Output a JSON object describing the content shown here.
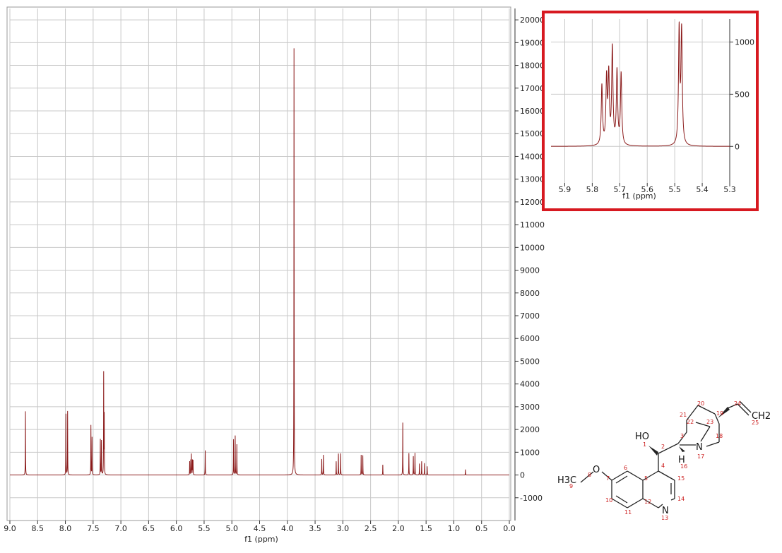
{
  "chart_data": [
    {
      "type": "line",
      "xlabel": "f1 (ppm)",
      "ylabel": "",
      "xlim": [
        9.0,
        0.0
      ],
      "ylim": [
        -2000,
        20500
      ],
      "x_ticks": [
        9.0,
        8.5,
        8.0,
        7.5,
        7.0,
        6.5,
        6.0,
        5.5,
        5.0,
        4.5,
        4.0,
        3.5,
        3.0,
        2.5,
        2.0,
        1.5,
        1.0,
        0.5,
        0.0
      ],
      "x_tick_labels": [
        "9.0",
        "8.5",
        "8.0",
        "7.5",
        "7.0",
        "6.5",
        "6.0",
        "5.5",
        "5.0",
        "4.5",
        "4.0",
        "3.5",
        "3.0",
        "2.5",
        "2.0",
        "1.5",
        "1.0",
        "0.5",
        "0.0"
      ],
      "y_ticks": [
        -1000,
        0,
        1000,
        2000,
        3000,
        4000,
        5000,
        6000,
        7000,
        8000,
        9000,
        10000,
        11000,
        12000,
        13000,
        14000,
        15000,
        16000,
        17000,
        18000,
        19000,
        20000
      ],
      "y_tick_labels": [
        "-1000",
        "0",
        "1000",
        "2000",
        "3000",
        "4000",
        "5000",
        "6000",
        "7000",
        "8000",
        "9000",
        "10000",
        "11000",
        "12000",
        "13000",
        "14000",
        "15000",
        "16000",
        "17000",
        "18000",
        "19000",
        "20000"
      ],
      "grid": true,
      "line_color": "#8b1a1a",
      "series": [
        {
          "peaks": [
            {
              "x": 8.72,
              "y": 2800
            },
            {
              "x": 7.99,
              "y": 2680
            },
            {
              "x": 7.96,
              "y": 2800
            },
            {
              "x": 7.54,
              "y": 2180
            },
            {
              "x": 7.52,
              "y": 1650
            },
            {
              "x": 7.37,
              "y": 1560
            },
            {
              "x": 7.35,
              "y": 1500
            },
            {
              "x": 7.31,
              "y": 4440
            },
            {
              "x": 7.3,
              "y": 2560
            },
            {
              "x": 5.76,
              "y": 590
            },
            {
              "x": 5.74,
              "y": 630
            },
            {
              "x": 5.73,
              "y": 900
            },
            {
              "x": 5.71,
              "y": 640
            },
            {
              "x": 5.7,
              "y": 630
            },
            {
              "x": 5.48,
              "y": 1080
            },
            {
              "x": 4.97,
              "y": 1560
            },
            {
              "x": 4.94,
              "y": 1720
            },
            {
              "x": 4.91,
              "y": 1340
            },
            {
              "x": 3.88,
              "y": 18750
            },
            {
              "x": 3.38,
              "y": 700
            },
            {
              "x": 3.35,
              "y": 880
            },
            {
              "x": 3.12,
              "y": 600
            },
            {
              "x": 3.08,
              "y": 940
            },
            {
              "x": 3.04,
              "y": 950
            },
            {
              "x": 2.67,
              "y": 880
            },
            {
              "x": 2.64,
              "y": 860
            },
            {
              "x": 2.28,
              "y": 450
            },
            {
              "x": 1.92,
              "y": 2300
            },
            {
              "x": 1.81,
              "y": 960
            },
            {
              "x": 1.73,
              "y": 820
            },
            {
              "x": 1.7,
              "y": 970
            },
            {
              "x": 1.62,
              "y": 500
            },
            {
              "x": 1.58,
              "y": 600
            },
            {
              "x": 1.53,
              "y": 520
            },
            {
              "x": 1.48,
              "y": 380
            },
            {
              "x": 0.79,
              "y": 240
            }
          ]
        }
      ]
    },
    {
      "type": "line",
      "xlabel": "f1 (ppm)",
      "ylabel": "",
      "xlim": [
        5.95,
        5.3
      ],
      "ylim": [
        -350,
        1220
      ],
      "x_ticks": [
        5.9,
        5.8,
        5.7,
        5.6,
        5.5,
        5.4,
        5.3
      ],
      "x_tick_labels": [
        "5.9",
        "5.8",
        "5.7",
        "5.6",
        "5.5",
        "5.4",
        "5.3"
      ],
      "y_ticks": [
        0,
        500,
        1000
      ],
      "y_tick_labels": [
        "0",
        "500",
        "1000"
      ],
      "grid": true,
      "line_color": "#8b1a1a",
      "highlight_border_color": "#d71920",
      "series": [
        {
          "peaks": [
            {
              "x": 5.765,
              "y": 570
            },
            {
              "x": 5.748,
              "y": 620
            },
            {
              "x": 5.74,
              "y": 650
            },
            {
              "x": 5.727,
              "y": 920
            },
            {
              "x": 5.71,
              "y": 700
            },
            {
              "x": 5.695,
              "y": 680
            },
            {
              "x": 5.484,
              "y": 1100
            },
            {
              "x": 5.475,
              "y": 1080
            }
          ]
        }
      ]
    }
  ],
  "structure": {
    "atoms": [
      "H3C",
      "O",
      "HO",
      "H",
      "N",
      "N",
      "CH2"
    ],
    "numbers": [
      "1",
      "2",
      "3",
      "4",
      "5",
      "6",
      "7",
      "8",
      "9",
      "10",
      "11",
      "12",
      "13",
      "14",
      "15",
      "16",
      "17",
      "18",
      "19",
      "20",
      "21",
      "22",
      "23",
      "24",
      "25"
    ]
  }
}
